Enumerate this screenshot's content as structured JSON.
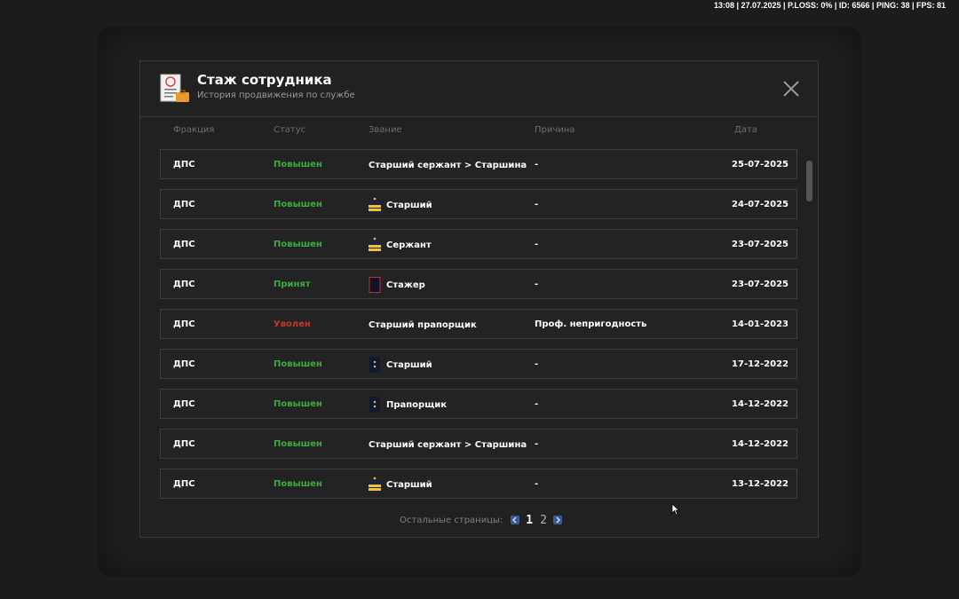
{
  "hud": {
    "text": "13:08 | 27.07.2025 | P.LOSS: 0% | ID: 6566 | PING: 38 | FPS: 81"
  },
  "modal": {
    "title": "Стаж сотрудника",
    "subtitle": "История продвижения по службе"
  },
  "columns": {
    "faction": "Фракция",
    "status": "Статус",
    "rank": "Звание",
    "reason": "Причина",
    "date": "Дата"
  },
  "rows": [
    {
      "faction": "ДПС",
      "status": "Повышен",
      "status_type": "up",
      "rank": "Старший сержант > Старшина",
      "rank_icon": "none",
      "reason": "-",
      "date": "25-07-2025"
    },
    {
      "faction": "ДПС",
      "status": "Повышен",
      "status_type": "up",
      "rank": "Старший",
      "rank_icon": "gold-shoulder-icon",
      "reason": "-",
      "date": "24-07-2025"
    },
    {
      "faction": "ДПС",
      "status": "Повышен",
      "status_type": "up",
      "rank": "Сержант",
      "rank_icon": "gold-shoulder-icon",
      "reason": "-",
      "date": "23-07-2025"
    },
    {
      "faction": "ДПС",
      "status": "Принят",
      "status_type": "up",
      "rank": "Стажер",
      "rank_icon": "red-shoulder-icon",
      "reason": "-",
      "date": "23-07-2025"
    },
    {
      "faction": "ДПС",
      "status": "Уволен",
      "status_type": "fire",
      "rank": "Старший прапорщик",
      "rank_icon": "none",
      "reason": "Проф. непригодность",
      "date": "14-01-2023"
    },
    {
      "faction": "ДПС",
      "status": "Повышен",
      "status_type": "up",
      "rank": "Старший",
      "rank_icon": "navy-shoulder-icon",
      "reason": "-",
      "date": "17-12-2022"
    },
    {
      "faction": "ДПС",
      "status": "Повышен",
      "status_type": "up",
      "rank": "Прапорщик",
      "rank_icon": "navy-shoulder-icon",
      "reason": "-",
      "date": "14-12-2022"
    },
    {
      "faction": "ДПС",
      "status": "Повышен",
      "status_type": "up",
      "rank": "Старший сержант > Старшина",
      "rank_icon": "none",
      "reason": "-",
      "date": "14-12-2022"
    },
    {
      "faction": "ДПС",
      "status": "Повышен",
      "status_type": "up",
      "rank": "Старший",
      "rank_icon": "gold-shoulder-icon",
      "reason": "-",
      "date": "13-12-2022"
    }
  ],
  "pagination": {
    "label": "Остальные страницы:",
    "pages": [
      "1",
      "2"
    ],
    "current": "1"
  },
  "colors": {
    "promoted": "#3dab3d",
    "fired": "#c0392b",
    "page_arrow": "#3a5a9a"
  }
}
